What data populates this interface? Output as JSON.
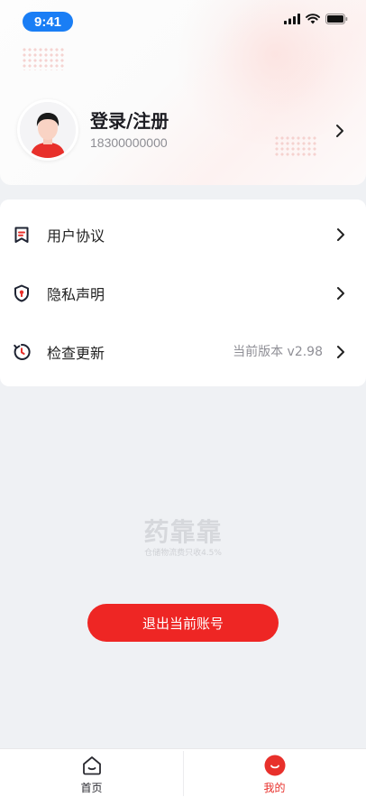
{
  "status_bar": {
    "time": "9:41"
  },
  "profile": {
    "name": "登录/注册",
    "phone": "18300000000"
  },
  "menu": {
    "items": [
      {
        "label": "用户协议",
        "icon": "document-bookmark-icon",
        "value": ""
      },
      {
        "label": "隐私声明",
        "icon": "shield-lock-icon",
        "value": ""
      },
      {
        "label": "检查更新",
        "icon": "refresh-clock-icon",
        "value": "当前版本 v2.98"
      }
    ]
  },
  "brand": {
    "logo_text": "药靠靠",
    "slogan": "仓储物流费只收4.5%"
  },
  "logout": {
    "label": "退出当前账号"
  },
  "tabbar": {
    "items": [
      {
        "label": "首页",
        "icon": "home-icon",
        "active": false
      },
      {
        "label": "我的",
        "icon": "profile-icon",
        "active": true
      }
    ]
  },
  "colors": {
    "accent": "#ee2624",
    "time_pill": "#1a7ef5",
    "background": "#eff1f4"
  }
}
